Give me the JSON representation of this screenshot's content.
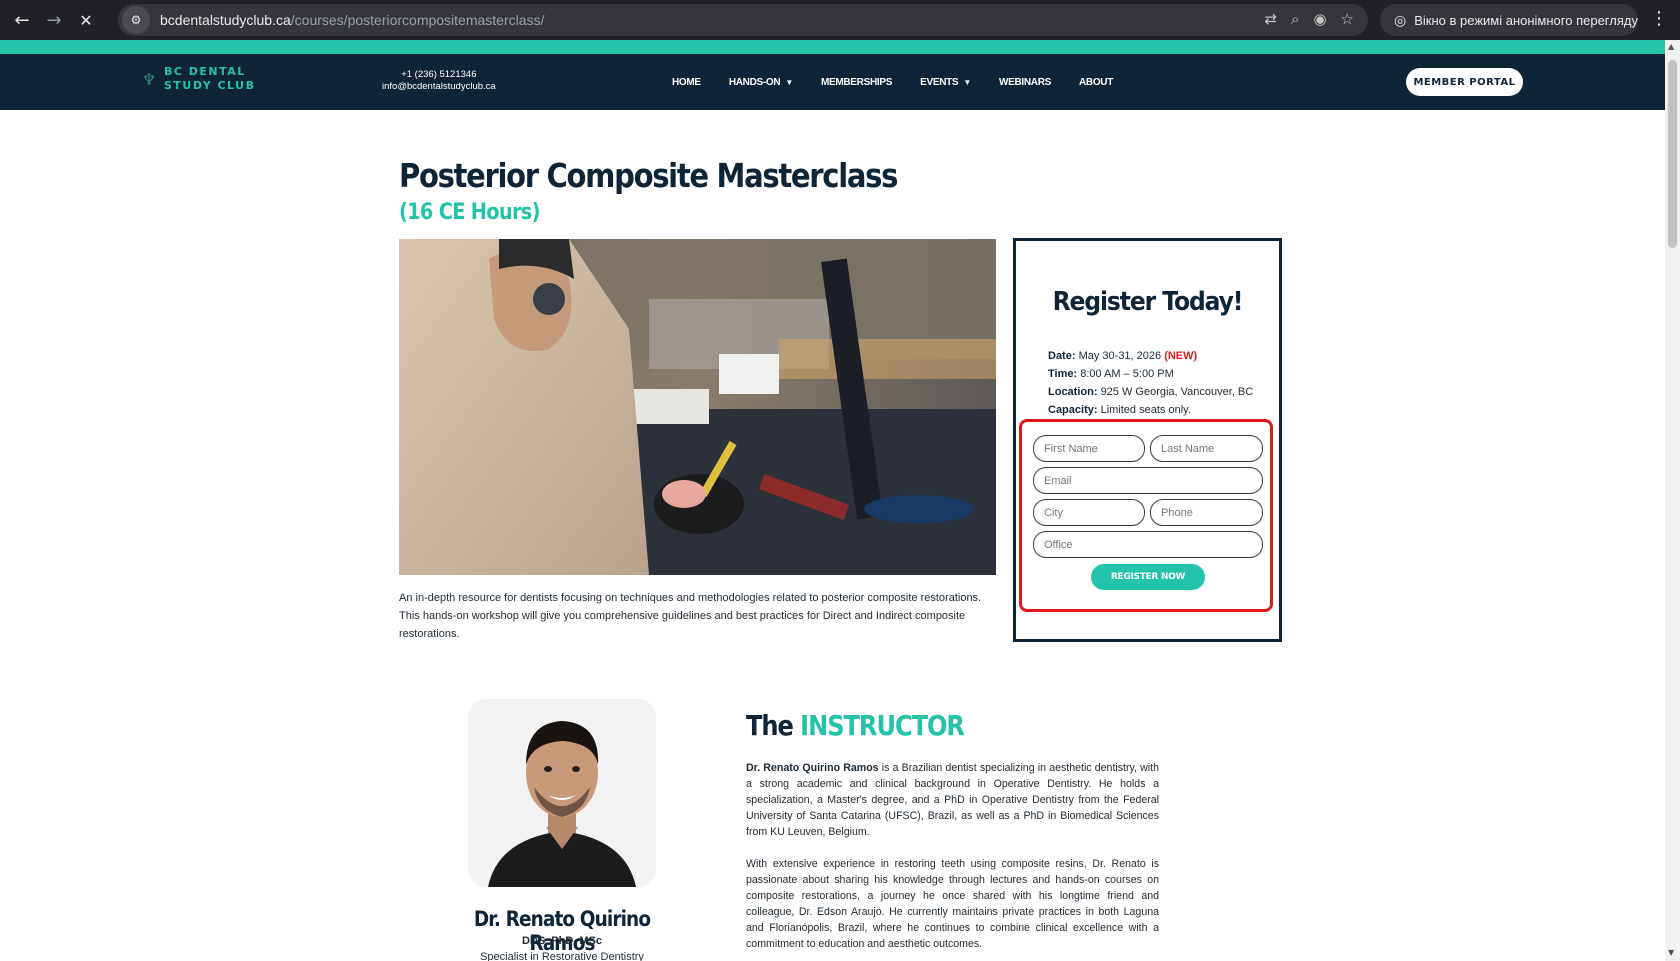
{
  "browser": {
    "url_host": "bcdentalstudyclub.ca",
    "url_path": "/courses/posteriorcompositemasterclass/",
    "incognito_label": "Вікно в режимі анонімного перегляду"
  },
  "header": {
    "logo_line1": "BC DENTAL",
    "logo_line2": "STUDY CLUB",
    "phone": "+1 (236) 5121346",
    "email": "info@bcdentalstudyclub.ca",
    "nav": {
      "home": "HOME",
      "hands_on": "HANDS-ON",
      "memberships": "MEMBERSHIPS",
      "events": "EVENTS",
      "webinars": "WEBINARS",
      "about": "ABOUT"
    },
    "portal_button": "MEMBER PORTAL"
  },
  "course": {
    "title": "Posterior Composite Masterclass",
    "subtitle": "(16 CE Hours)",
    "description": "An in-depth resource for dentists focusing on techniques and methodologies related to posterior composite restorations. This hands-on workshop will give you comprehensive guidelines and best practices for Direct and Indirect composite restorations."
  },
  "register": {
    "title": "Register Today!",
    "date_label": "Date:",
    "date_value": "May 30-31, 2026",
    "date_badge": "(NEW)",
    "time_label": "Time:",
    "time_value": "8:00 AM – 5:00 PM",
    "location_label": "Location:",
    "location_value": "925 W Georgia, Vancouver, BC",
    "capacity_label": "Capacity:",
    "capacity_value": "Limited seats only.",
    "fields": {
      "first_name": "First Name",
      "last_name": "Last Name",
      "email": "Email",
      "city": "City",
      "phone": "Phone",
      "office": "Office"
    },
    "button": "REGISTER NOW"
  },
  "instructor": {
    "heading_prefix": "The",
    "heading_accent": "INSTRUCTOR",
    "name": "Dr. Renato Quirino Ramos",
    "credentials": "DDS, PhD, MSc",
    "specialty": "Specialist in Restorative Dentistry",
    "bio_name": "Dr. Renato Quirino Ramos",
    "bio_p1_rest": " is a Brazilian dentist specializing in aesthetic dentistry, with a strong academic and clinical background in Operative Dentistry. He holds a specialization, a Master's degree, and a PhD in Operative Dentistry from the Federal University of Santa Catarina (UFSC), Brazil, as well as a PhD in Biomedical Sciences from KU Leuven, Belgium.",
    "bio_p2": "With extensive experience in restoring teeth using composite resins, Dr. Renato is passionate about sharing his knowledge through lectures and hands-on courses on composite restorations, a journey he once shared with his longtime friend and colleague, Dr. Edson Araujo. He currently maintains private practices in both Laguna and Florianópolis, Brazil, where he continues to combine clinical excellence with a commitment to education and aesthetic outcomes."
  }
}
